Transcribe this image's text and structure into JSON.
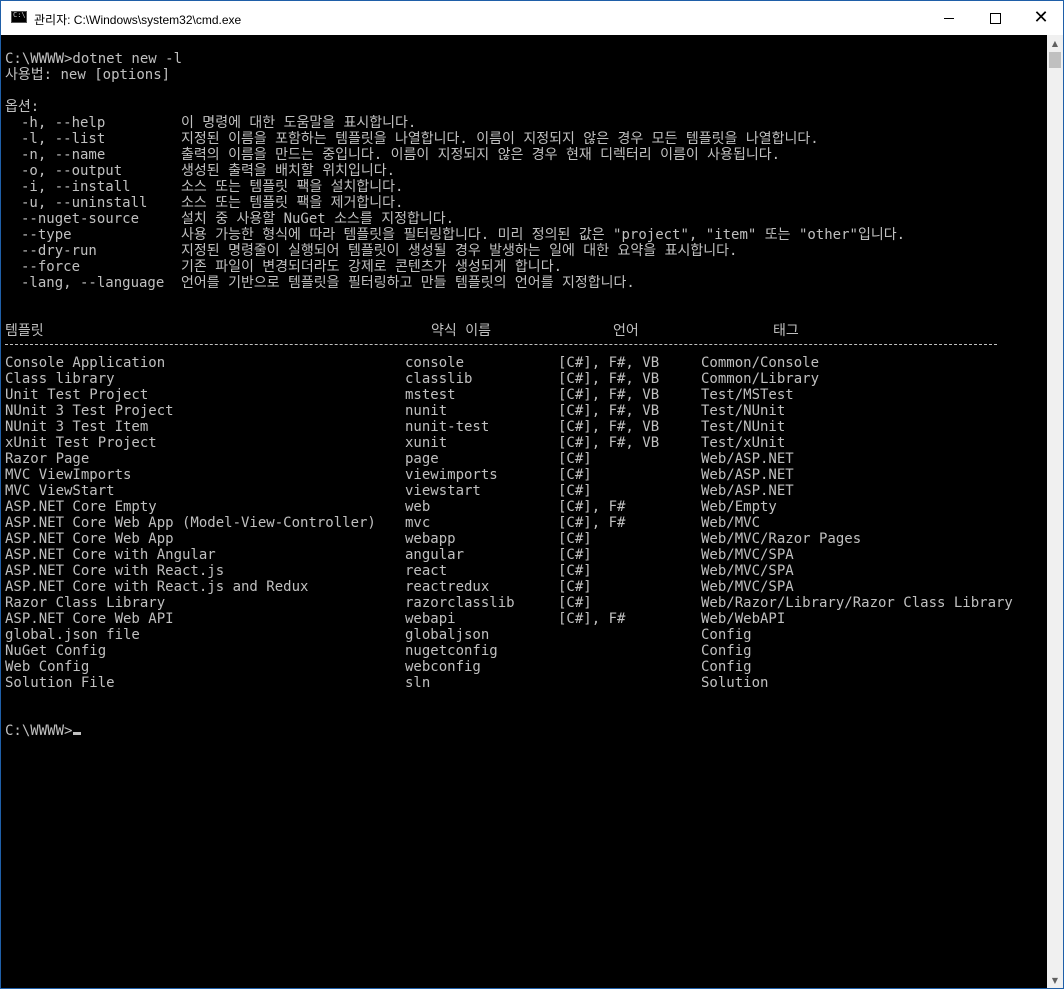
{
  "window": {
    "title": "관리자: C:\\Windows\\system32\\cmd.exe",
    "minimize": "—",
    "maximize": "☐",
    "close": "✕"
  },
  "console": {
    "intro": [
      "C:\\WWWW>dotnet new -l",
      "사용법: new [options]"
    ],
    "options_header": "옵션:",
    "options": [
      {
        "flag": "-h, --help",
        "desc": "이 명령에 대한 도움말을 표시합니다."
      },
      {
        "flag": "-l, --list",
        "desc": "지정된 이름을 포함하는 템플릿을 나열합니다. 이름이 지정되지 않은 경우 모든 템플릿을 나열합니다."
      },
      {
        "flag": "-n, --name",
        "desc": "출력의 이름을 만드는 중입니다. 이름이 지정되지 않은 경우 현재 디렉터리 이름이 사용됩니다."
      },
      {
        "flag": "-o, --output",
        "desc": "생성된 출력을 배치할 위치입니다."
      },
      {
        "flag": "-i, --install",
        "desc": "소스 또는 템플릿 팩을 설치합니다."
      },
      {
        "flag": "-u, --uninstall",
        "desc": "소스 또는 템플릿 팩을 제거합니다."
      },
      {
        "flag": "--nuget-source",
        "desc": "설치 중 사용할 NuGet 소스를 지정합니다."
      },
      {
        "flag": "--type",
        "desc": "사용 가능한 형식에 따라 템플릿을 필터링합니다. 미리 정의된 값은 \"project\", \"item\" 또는 \"other\"입니다."
      },
      {
        "flag": "--dry-run",
        "desc": "지정된 명령줄이 실행되어 템플릿이 생성될 경우 발생하는 일에 대한 요약을 표시합니다."
      },
      {
        "flag": "--force",
        "desc": "기존 파일이 변경되더라도 강제로 콘텐츠가 생성되게 합니다."
      },
      {
        "flag": "-lang, --language",
        "desc": "언어를 기반으로 템플릿을 필터링하고 만들 템플릿의 언어를 지정합니다."
      }
    ],
    "table_headers": {
      "template": "템플릿",
      "short_name": "약식 이름",
      "language": "언어",
      "tags": "태그"
    },
    "templates": [
      {
        "name": "Console Application",
        "short": "console",
        "lang": "[C#], F#, VB",
        "tags": "Common/Console"
      },
      {
        "name": "Class library",
        "short": "classlib",
        "lang": "[C#], F#, VB",
        "tags": "Common/Library"
      },
      {
        "name": "Unit Test Project",
        "short": "mstest",
        "lang": "[C#], F#, VB",
        "tags": "Test/MSTest"
      },
      {
        "name": "NUnit 3 Test Project",
        "short": "nunit",
        "lang": "[C#], F#, VB",
        "tags": "Test/NUnit"
      },
      {
        "name": "NUnit 3 Test Item",
        "short": "nunit-test",
        "lang": "[C#], F#, VB",
        "tags": "Test/NUnit"
      },
      {
        "name": "xUnit Test Project",
        "short": "xunit",
        "lang": "[C#], F#, VB",
        "tags": "Test/xUnit"
      },
      {
        "name": "Razor Page",
        "short": "page",
        "lang": "[C#]",
        "tags": "Web/ASP.NET"
      },
      {
        "name": "MVC ViewImports",
        "short": "viewimports",
        "lang": "[C#]",
        "tags": "Web/ASP.NET"
      },
      {
        "name": "MVC ViewStart",
        "short": "viewstart",
        "lang": "[C#]",
        "tags": "Web/ASP.NET"
      },
      {
        "name": "ASP.NET Core Empty",
        "short": "web",
        "lang": "[C#], F#",
        "tags": "Web/Empty"
      },
      {
        "name": "ASP.NET Core Web App (Model-View-Controller)",
        "short": "mvc",
        "lang": "[C#], F#",
        "tags": "Web/MVC"
      },
      {
        "name": "ASP.NET Core Web App",
        "short": "webapp",
        "lang": "[C#]",
        "tags": "Web/MVC/Razor Pages"
      },
      {
        "name": "ASP.NET Core with Angular",
        "short": "angular",
        "lang": "[C#]",
        "tags": "Web/MVC/SPA"
      },
      {
        "name": "ASP.NET Core with React.js",
        "short": "react",
        "lang": "[C#]",
        "tags": "Web/MVC/SPA"
      },
      {
        "name": "ASP.NET Core with React.js and Redux",
        "short": "reactredux",
        "lang": "[C#]",
        "tags": "Web/MVC/SPA"
      },
      {
        "name": "Razor Class Library",
        "short": "razorclasslib",
        "lang": "[C#]",
        "tags": "Web/Razor/Library/Razor Class Library"
      },
      {
        "name": "ASP.NET Core Web API",
        "short": "webapi",
        "lang": "[C#], F#",
        "tags": "Web/WebAPI"
      },
      {
        "name": "global.json file",
        "short": "globaljson",
        "lang": "",
        "tags": "Config"
      },
      {
        "name": "NuGet Config",
        "short": "nugetconfig",
        "lang": "",
        "tags": "Config"
      },
      {
        "name": "Web Config",
        "short": "webconfig",
        "lang": "",
        "tags": "Config"
      },
      {
        "name": "Solution File",
        "short": "sln",
        "lang": "",
        "tags": "Solution"
      }
    ],
    "prompt": "C:\\WWWW>"
  },
  "colors": {
    "console_bg": "#000000",
    "console_fg": "#c0c0c0",
    "titlebar_bg": "#ffffff"
  }
}
